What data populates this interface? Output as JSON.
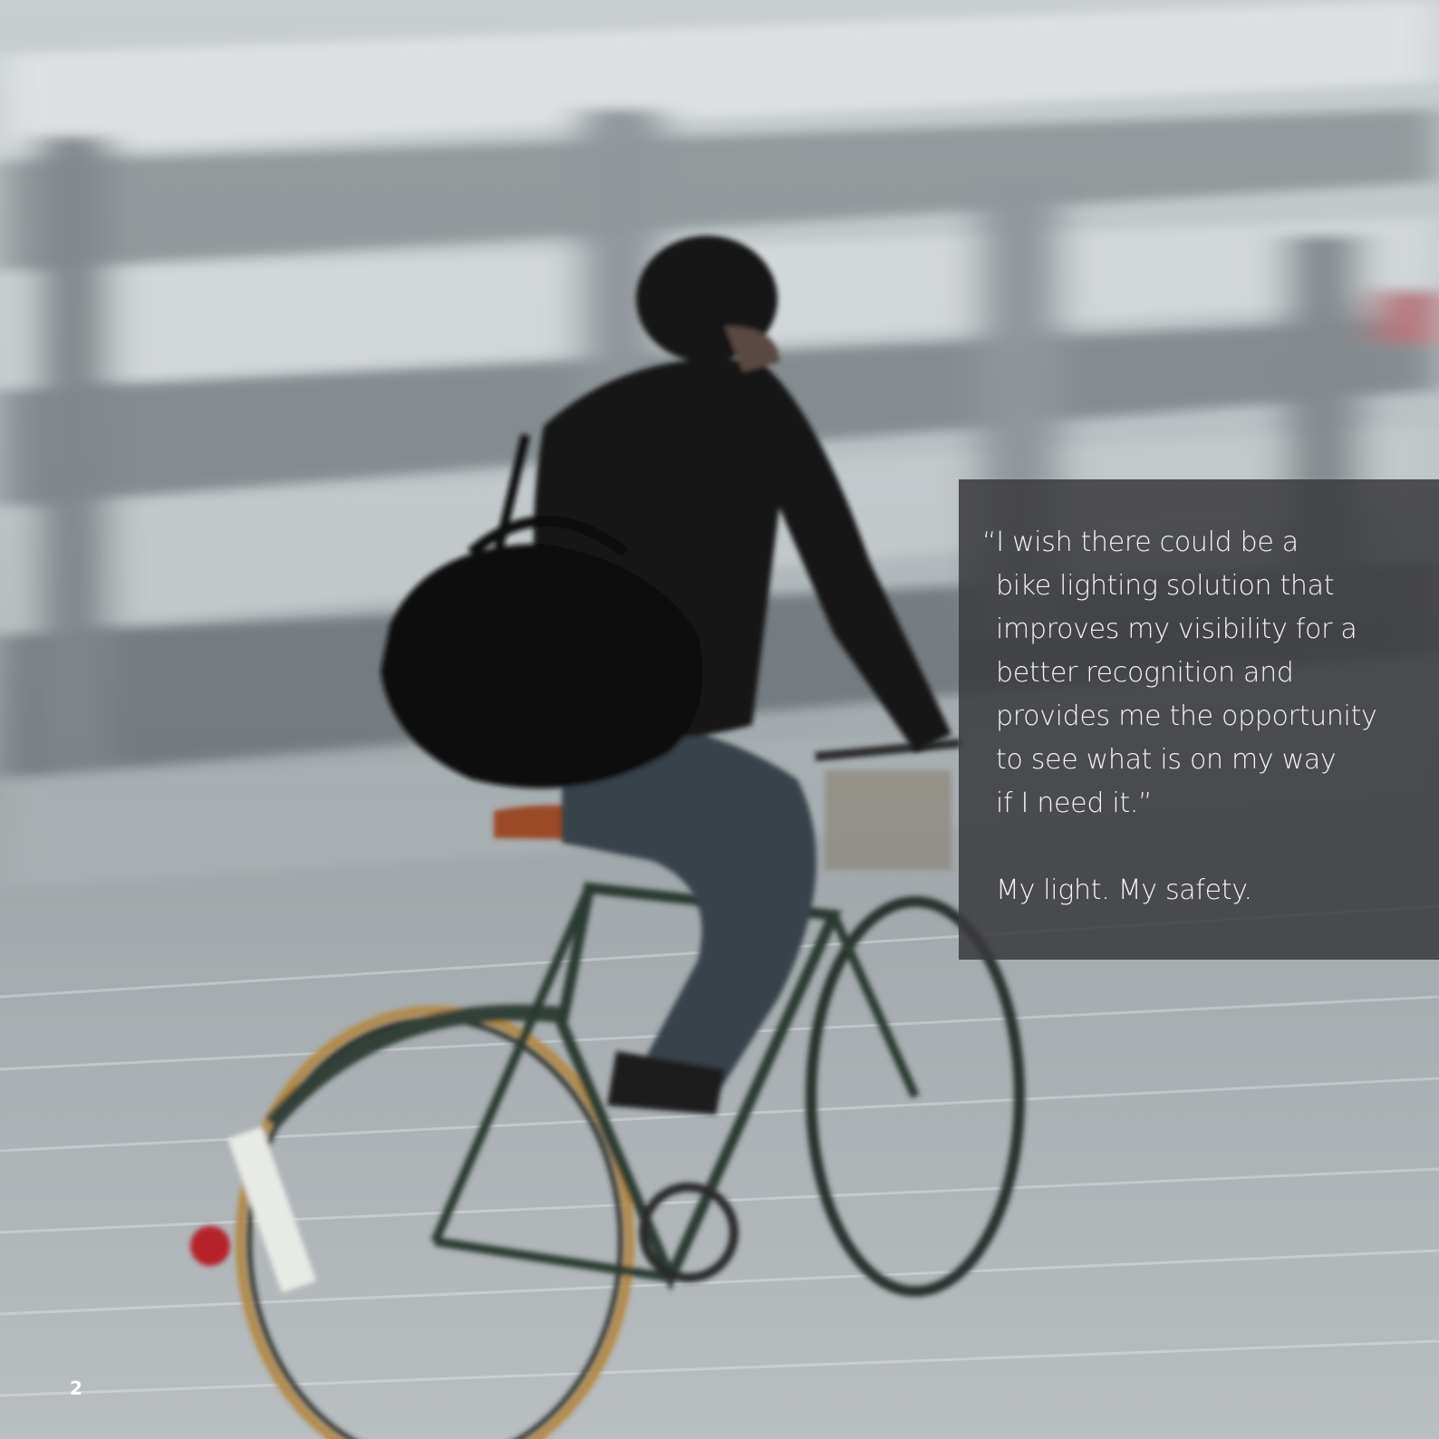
{
  "quote": {
    "lines": [
      "“I wish there could be a",
      "bike lighting solution that",
      "improves my visibility for a",
      "better recognition and",
      "provides me the opportunity",
      "to see what is on my way",
      "if I need it.”"
    ],
    "tagline": "My light. My safety."
  },
  "page_number": "2",
  "colors": {
    "panel": "#3a3a3e",
    "text": "#f3f3f3"
  }
}
